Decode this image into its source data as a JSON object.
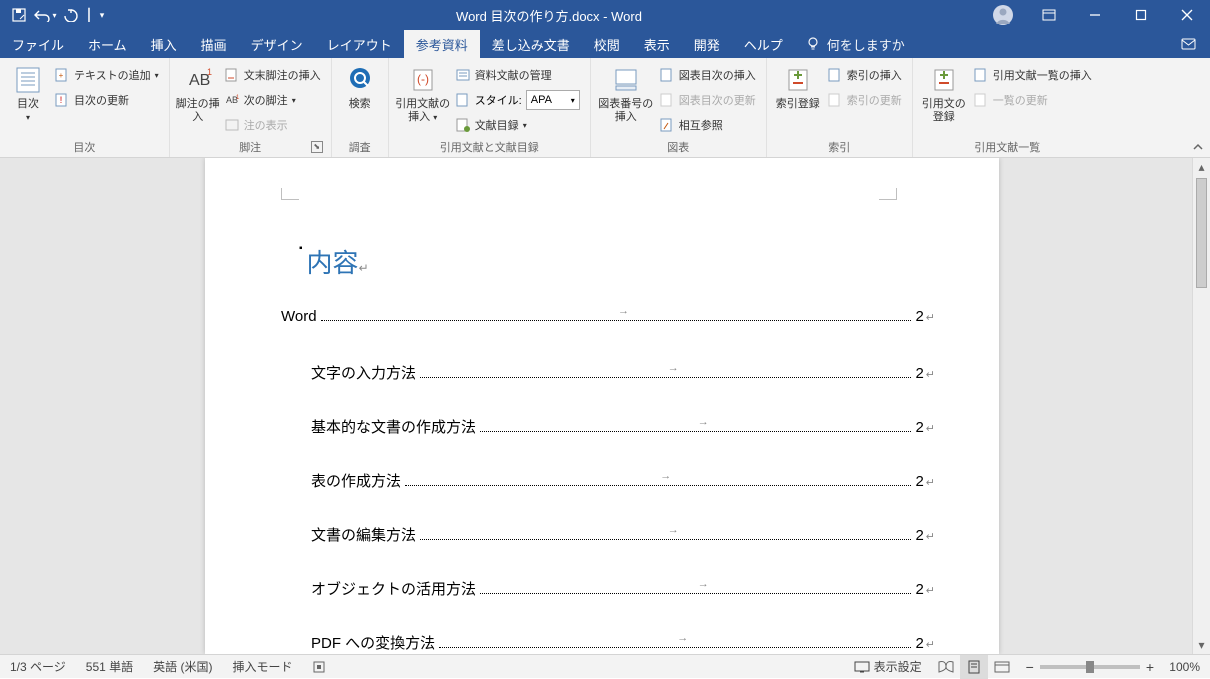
{
  "title": "Word  目次の作り方.docx  -  Word",
  "tabs": {
    "file": "ファイル",
    "home": "ホーム",
    "insert": "挿入",
    "draw": "描画",
    "design": "デザイン",
    "layout": "レイアウト",
    "references": "参考資料",
    "mailings": "差し込み文書",
    "review": "校閲",
    "view": "表示",
    "developer": "開発",
    "help": "ヘルプ",
    "tellme": "何をしますか"
  },
  "ribbon": {
    "toc": {
      "group": "目次",
      "button": "目次",
      "addText": "テキストの追加",
      "update": "目次の更新"
    },
    "footnotes": {
      "group": "脚注",
      "insert": "脚注の挿入",
      "endnote": "文末脚注の挿入",
      "next": "次の脚注",
      "show": "注の表示"
    },
    "research": {
      "group": "調査",
      "search": "検索"
    },
    "citations": {
      "group": "引用文献と文献目録",
      "insert": "引用文献の挿入",
      "manage": "資料文献の管理",
      "styleLabel": "スタイル:",
      "styleValue": "APA",
      "bibliography": "文献目録"
    },
    "captions": {
      "group": "図表",
      "insert": "図表番号の挿入",
      "tof": "図表目次の挿入",
      "update": "図表目次の更新",
      "crossref": "相互参照"
    },
    "index": {
      "group": "索引",
      "mark": "索引登録",
      "insert": "索引の挿入",
      "update": "索引の更新"
    },
    "authorities": {
      "group": "引用文献一覧",
      "mark": "引用文の登録",
      "insert": "引用文献一覧の挿入",
      "update": "一覧の更新"
    }
  },
  "document": {
    "tocTitle": "内容",
    "entries": [
      {
        "level": 1,
        "text": "Word",
        "page": "2"
      },
      {
        "level": 2,
        "text": "文字の入力方法",
        "page": "2"
      },
      {
        "level": 2,
        "text": "基本的な文書の作成方法",
        "page": "2"
      },
      {
        "level": 2,
        "text": "表の作成方法",
        "page": "2"
      },
      {
        "level": 2,
        "text": "文書の編集方法",
        "page": "2"
      },
      {
        "level": 2,
        "text": "オブジェクトの活用方法",
        "page": "2"
      },
      {
        "level": 2,
        "text": "PDF への変換方法",
        "page": "2"
      }
    ]
  },
  "status": {
    "page": "1/3 ページ",
    "words": "551 単語",
    "language": "英語 (米国)",
    "mode": "挿入モード",
    "display": "表示設定",
    "zoom": "100%"
  }
}
